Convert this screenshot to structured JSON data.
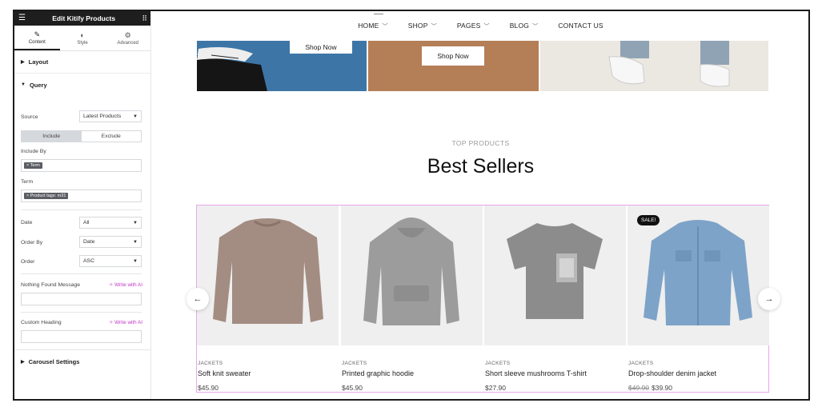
{
  "panel": {
    "title": "Edit Kitify Products",
    "tabs": [
      {
        "label": "Content",
        "icon": "pencil-icon"
      },
      {
        "label": "Style",
        "icon": "half-circle-icon"
      },
      {
        "label": "Advanced",
        "icon": "gear-icon"
      }
    ],
    "sections": {
      "layout": "Layout",
      "query": "Query",
      "carousel": "Carousel Settings"
    },
    "source": {
      "label": "Source",
      "value": "Latest Products"
    },
    "include_toggle": {
      "include": "Include",
      "exclude": "Exclude"
    },
    "include_by": {
      "label": "Include By",
      "chip": "× Term"
    },
    "term": {
      "label": "Term",
      "chip": "× Product tags: m31"
    },
    "date": {
      "label": "Date",
      "value": "All"
    },
    "order_by": {
      "label": "Order By",
      "value": "Date"
    },
    "order": {
      "label": "Order",
      "value": "ASC"
    },
    "nothing_found": {
      "label": "Nothing Found Message",
      "ai": "✧ Write with AI",
      "value": ""
    },
    "custom_heading": {
      "label": "Custom Heading",
      "ai": "✧ Write with AI",
      "value": ""
    }
  },
  "nav": {
    "items": [
      {
        "label": "HOME",
        "has_dropdown": true
      },
      {
        "label": "SHOP",
        "has_dropdown": true
      },
      {
        "label": "PAGES",
        "has_dropdown": true
      },
      {
        "label": "BLOG",
        "has_dropdown": true
      },
      {
        "label": "CONTACT US",
        "has_dropdown": false
      }
    ]
  },
  "banners": {
    "shop_now_1": "Shop Now",
    "shop_now_2": "Shop Now"
  },
  "section": {
    "eyebrow": "TOP PRODUCTS",
    "heading": "Best Sellers"
  },
  "products": [
    {
      "category": "JACKETS",
      "name": "Soft knit sweater",
      "price": "$45.90",
      "old_price": "",
      "badge": ""
    },
    {
      "category": "JACKETS",
      "name": "Printed graphic hoodie",
      "price": "$45.90",
      "old_price": "",
      "badge": ""
    },
    {
      "category": "JACKETS",
      "name": "Short sleeve mushrooms T-shirt",
      "price": "$27.90",
      "old_price": "",
      "badge": ""
    },
    {
      "category": "JACKETS",
      "name": "Drop-shoulder denim jacket",
      "price": "$39.90",
      "old_price": "$49.90",
      "badge": "SALE!"
    }
  ],
  "carousel": {
    "prev": "←",
    "next": "→"
  },
  "colors": {
    "accent_ai": "#c036c5",
    "grid_outline": "#e9a6ec",
    "header_dark": "#1e1e1e"
  }
}
